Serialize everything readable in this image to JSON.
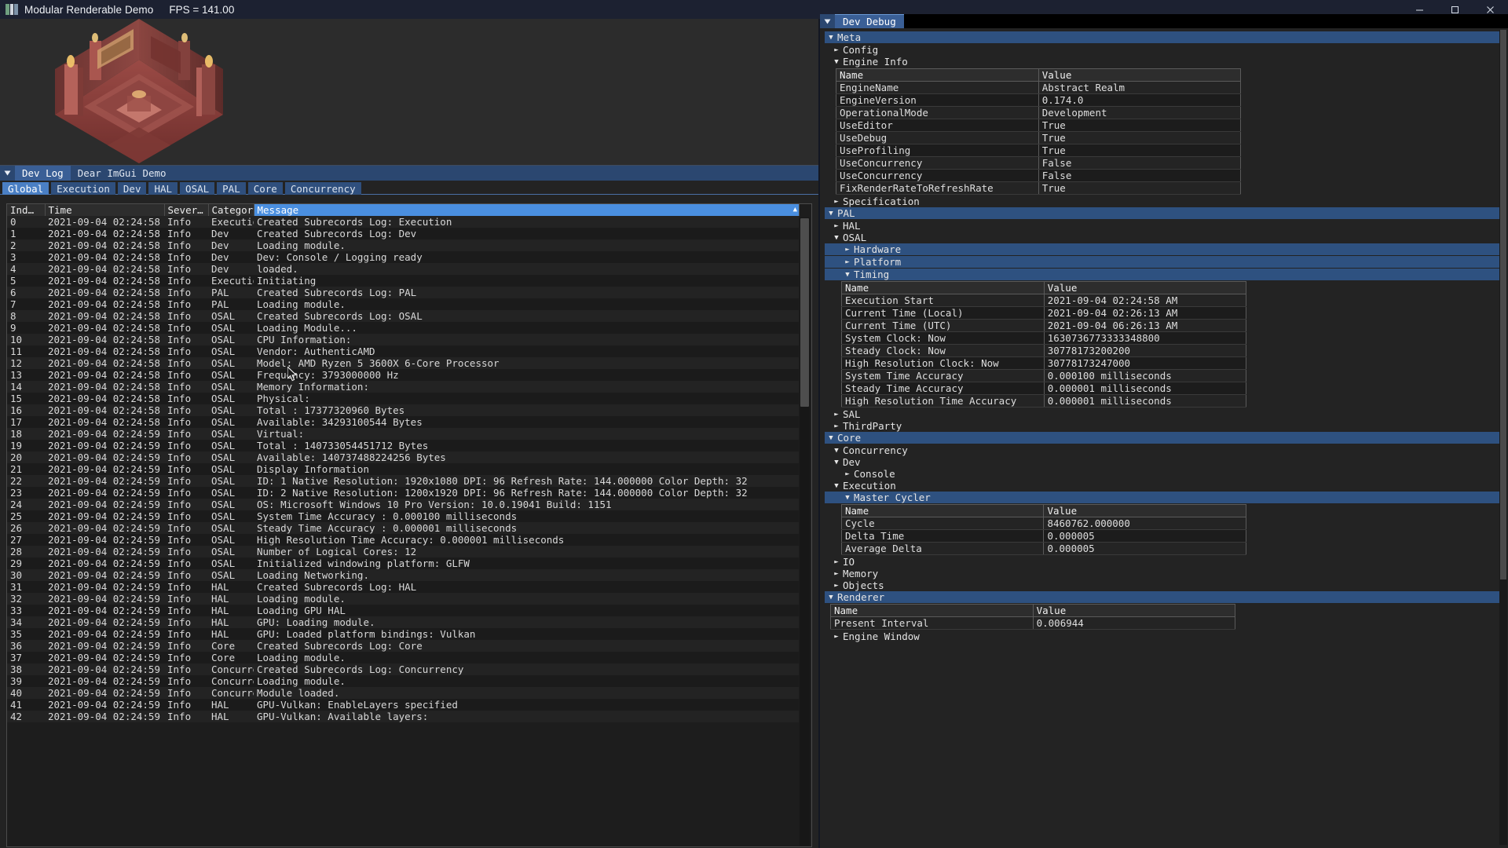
{
  "window": {
    "title": "Modular Renderable Demo",
    "fps_label": "FPS = 141.00",
    "icon": "app-icon",
    "minimize": "minimize",
    "maximize": "maximize",
    "close": "close"
  },
  "viewport": {
    "name": "3d-render-viewport"
  },
  "devlog": {
    "collapse_icon": "collapse-arrow-icon",
    "tabs": [
      {
        "label": "Dev Log",
        "active": true
      },
      {
        "label": "Dear ImGui Demo",
        "active": false
      }
    ],
    "subtabs": [
      {
        "label": "Global",
        "active": true
      },
      {
        "label": "Execution",
        "active": false
      },
      {
        "label": "Dev",
        "active": false
      },
      {
        "label": "HAL",
        "active": false
      },
      {
        "label": "OSAL",
        "active": false
      },
      {
        "label": "PAL",
        "active": false
      },
      {
        "label": "Core",
        "active": false
      },
      {
        "label": "Concurrency",
        "active": false
      }
    ],
    "columns": [
      "Ind…",
      "Time",
      "Sever…",
      "Category",
      "Message"
    ],
    "rows": [
      [
        "0",
        "2021-09-04 02:24:58",
        "Info",
        "Execution",
        "Created Subrecords Log: Execution"
      ],
      [
        "1",
        "2021-09-04 02:24:58",
        "Info",
        "Dev",
        "Created Subrecords Log: Dev"
      ],
      [
        "2",
        "2021-09-04 02:24:58",
        "Info",
        "Dev",
        "Loading module."
      ],
      [
        "3",
        "2021-09-04 02:24:58",
        "Info",
        "Dev",
        "Dev: Console / Logging ready"
      ],
      [
        "4",
        "2021-09-04 02:24:58",
        "Info",
        "Dev",
        "loaded."
      ],
      [
        "5",
        "2021-09-04 02:24:58",
        "Info",
        "Execution",
        "Initiating"
      ],
      [
        "6",
        "2021-09-04 02:24:58",
        "Info",
        "PAL",
        "Created Subrecords Log: PAL"
      ],
      [
        "7",
        "2021-09-04 02:24:58",
        "Info",
        "PAL",
        "Loading module."
      ],
      [
        "8",
        "2021-09-04 02:24:58",
        "Info",
        "OSAL",
        "Created Subrecords Log: OSAL"
      ],
      [
        "9",
        "2021-09-04 02:24:58",
        "Info",
        "OSAL",
        "Loading Module..."
      ],
      [
        "10",
        "2021-09-04 02:24:58",
        "Info",
        "OSAL",
        "CPU Information:"
      ],
      [
        "11",
        "2021-09-04 02:24:58",
        "Info",
        "OSAL",
        "Vendor: AuthenticAMD"
      ],
      [
        "12",
        "2021-09-04 02:24:58",
        "Info",
        "OSAL",
        "Model: AMD Ryzen 5 3600X 6-Core Processor"
      ],
      [
        "13",
        "2021-09-04 02:24:58",
        "Info",
        "OSAL",
        "Frequency: 3793000000 Hz"
      ],
      [
        "14",
        "2021-09-04 02:24:58",
        "Info",
        "OSAL",
        "Memory Information:"
      ],
      [
        "15",
        "2021-09-04 02:24:58",
        "Info",
        "OSAL",
        "Physical:"
      ],
      [
        "16",
        "2021-09-04 02:24:58",
        "Info",
        "OSAL",
        "Total    : 17377320960 Bytes"
      ],
      [
        "17",
        "2021-09-04 02:24:58",
        "Info",
        "OSAL",
        "Available: 34293100544 Bytes"
      ],
      [
        "18",
        "2021-09-04 02:24:59",
        "Info",
        "OSAL",
        "Virtual:"
      ],
      [
        "19",
        "2021-09-04 02:24:59",
        "Info",
        "OSAL",
        "Total    : 140733054451712 Bytes"
      ],
      [
        "20",
        "2021-09-04 02:24:59",
        "Info",
        "OSAL",
        "Available: 140737488224256 Bytes"
      ],
      [
        "21",
        "2021-09-04 02:24:59",
        "Info",
        "OSAL",
        "Display Information"
      ],
      [
        "22",
        "2021-09-04 02:24:59",
        "Info",
        "OSAL",
        "ID: 1 Native Resolution: 1920x1080 DPI: 96 Refresh Rate: 144.000000 Color Depth: 32"
      ],
      [
        "23",
        "2021-09-04 02:24:59",
        "Info",
        "OSAL",
        "ID: 2 Native Resolution: 1200x1920 DPI: 96 Refresh Rate: 144.000000 Color Depth: 32"
      ],
      [
        "24",
        "2021-09-04 02:24:59",
        "Info",
        "OSAL",
        "OS: Microsoft Windows 10 Pro Version: 10.0.19041 Build: 1151"
      ],
      [
        "25",
        "2021-09-04 02:24:59",
        "Info",
        "OSAL",
        "System Time Accuracy     : 0.000100 milliseconds"
      ],
      [
        "26",
        "2021-09-04 02:24:59",
        "Info",
        "OSAL",
        "Steady Time Accuracy     : 0.000001 milliseconds"
      ],
      [
        "27",
        "2021-09-04 02:24:59",
        "Info",
        "OSAL",
        "High Resolution Time Accuracy: 0.000001 milliseconds"
      ],
      [
        "28",
        "2021-09-04 02:24:59",
        "Info",
        "OSAL",
        "Number of Logical Cores: 12"
      ],
      [
        "29",
        "2021-09-04 02:24:59",
        "Info",
        "OSAL",
        "Initialized windowing platform: GLFW"
      ],
      [
        "30",
        "2021-09-04 02:24:59",
        "Info",
        "OSAL",
        "Loading Networking."
      ],
      [
        "31",
        "2021-09-04 02:24:59",
        "Info",
        "HAL",
        "Created Subrecords Log: HAL"
      ],
      [
        "32",
        "2021-09-04 02:24:59",
        "Info",
        "HAL",
        "Loading module."
      ],
      [
        "33",
        "2021-09-04 02:24:59",
        "Info",
        "HAL",
        "Loading GPU HAL"
      ],
      [
        "34",
        "2021-09-04 02:24:59",
        "Info",
        "HAL",
        "GPU: Loading module."
      ],
      [
        "35",
        "2021-09-04 02:24:59",
        "Info",
        "HAL",
        "GPU: Loaded platform bindings: Vulkan"
      ],
      [
        "36",
        "2021-09-04 02:24:59",
        "Info",
        "Core",
        "Created Subrecords Log: Core"
      ],
      [
        "37",
        "2021-09-04 02:24:59",
        "Info",
        "Core",
        "Loading module."
      ],
      [
        "38",
        "2021-09-04 02:24:59",
        "Info",
        "Concurrenc",
        "Created Subrecords Log: Concurrency"
      ],
      [
        "39",
        "2021-09-04 02:24:59",
        "Info",
        "Concurrenc",
        "Loading module."
      ],
      [
        "40",
        "2021-09-04 02:24:59",
        "Info",
        "Concurrenc",
        "Module loaded."
      ],
      [
        "41",
        "2021-09-04 02:24:59",
        "Info",
        "HAL",
        "GPU-Vulkan: EnableLayers specified"
      ],
      [
        "42",
        "2021-09-04 02:24:59",
        "Info",
        "HAL",
        "GPU-Vulkan: Available layers:"
      ]
    ]
  },
  "debug": {
    "collapse_icon": "collapse-arrow-icon",
    "tab_label": "Dev Debug",
    "tree": [
      {
        "id": "meta",
        "label": "Meta",
        "indent": 0,
        "state": "open",
        "header": true
      },
      {
        "id": "config",
        "label": "Config",
        "indent": 1,
        "state": "closed",
        "header": false
      },
      {
        "id": "engine-info",
        "label": "Engine Info",
        "indent": 1,
        "state": "open",
        "header": false
      },
      {
        "id": "specification",
        "label": "Specification",
        "indent": 1,
        "state": "closed",
        "header": false
      },
      {
        "id": "pal",
        "label": "PAL",
        "indent": 0,
        "state": "open",
        "header": true
      },
      {
        "id": "hal",
        "label": "HAL",
        "indent": 1,
        "state": "closed",
        "header": false
      },
      {
        "id": "osal",
        "label": "OSAL",
        "indent": 1,
        "state": "open",
        "header": false
      },
      {
        "id": "hardware",
        "label": "Hardware",
        "indent": 2,
        "state": "closed",
        "header": true
      },
      {
        "id": "platform",
        "label": "Platform",
        "indent": 2,
        "state": "closed",
        "header": true
      },
      {
        "id": "timing",
        "label": "Timing",
        "indent": 2,
        "state": "open",
        "header": true
      },
      {
        "id": "sal",
        "label": "SAL",
        "indent": 1,
        "state": "closed",
        "header": false
      },
      {
        "id": "thirdparty",
        "label": "ThirdParty",
        "indent": 1,
        "state": "closed",
        "header": false
      },
      {
        "id": "core",
        "label": "Core",
        "indent": 0,
        "state": "open",
        "header": true
      },
      {
        "id": "concurrency",
        "label": "Concurrency",
        "indent": 1,
        "state": "open",
        "header": false
      },
      {
        "id": "dev",
        "label": "Dev",
        "indent": 1,
        "state": "open",
        "header": false
      },
      {
        "id": "console",
        "label": "Console",
        "indent": 2,
        "state": "closed",
        "header": false
      },
      {
        "id": "execution",
        "label": "Execution",
        "indent": 1,
        "state": "open",
        "header": false
      },
      {
        "id": "master-cycler",
        "label": "Master Cycler",
        "indent": 2,
        "state": "open",
        "header": true
      },
      {
        "id": "io",
        "label": "IO",
        "indent": 1,
        "state": "closed",
        "header": false
      },
      {
        "id": "memory",
        "label": "Memory",
        "indent": 1,
        "state": "closed",
        "header": false
      },
      {
        "id": "objects",
        "label": "Objects",
        "indent": 1,
        "state": "closed",
        "header": false
      },
      {
        "id": "renderer",
        "label": "Renderer",
        "indent": 0,
        "state": "open",
        "header": true
      },
      {
        "id": "engine-window",
        "label": "Engine Window",
        "indent": 1,
        "state": "closed",
        "header": false
      }
    ],
    "tables": {
      "engine_info": {
        "columns": [
          "Name",
          "Value"
        ],
        "rows": [
          [
            "EngineName",
            "Abstract Realm"
          ],
          [
            "EngineVersion",
            "0.174.0"
          ],
          [
            "OperationalMode",
            "Development"
          ],
          [
            "UseEditor",
            "True"
          ],
          [
            "UseDebug",
            "True"
          ],
          [
            "UseProfiling",
            "True"
          ],
          [
            "UseConcurrency",
            "False"
          ],
          [
            "UseConcurrency",
            "False"
          ],
          [
            "FixRenderRateToRefreshRate",
            "True"
          ]
        ]
      },
      "timing": {
        "columns": [
          "Name",
          "Value"
        ],
        "rows": [
          [
            "Execution Start",
            "2021-09-04 02:24:58 AM"
          ],
          [
            "Current Time (Local)",
            "2021-09-04 02:26:13 AM"
          ],
          [
            "Current Time (UTC)",
            "2021-09-04 06:26:13 AM"
          ],
          [
            "System Clock: Now",
            "1630736773333348800"
          ],
          [
            "Steady Clock: Now",
            "30778173200200"
          ],
          [
            "High Resolution Clock: Now",
            "30778173247000"
          ],
          [
            "System Time Accuracy",
            "0.000100 milliseconds"
          ],
          [
            "Steady Time Accuracy",
            "0.000001 milliseconds"
          ],
          [
            "High Resolution Time Accuracy",
            "0.000001 milliseconds"
          ]
        ]
      },
      "master_cycler": {
        "columns": [
          "Name",
          "Value"
        ],
        "rows": [
          [
            "Cycle",
            "8460762.000000"
          ],
          [
            "Delta Time",
            "0.000005"
          ],
          [
            "Average Delta",
            "0.000005"
          ]
        ]
      },
      "renderer": {
        "columns": [
          "Name",
          "Value"
        ],
        "rows": [
          [
            "Present Interval",
            "0.006944"
          ]
        ]
      }
    }
  },
  "colors": {
    "accent_blue": "#4a8fe0",
    "header_blue": "#2e5180",
    "titlebar": "#1c2131",
    "panel_bg": "#232323"
  }
}
